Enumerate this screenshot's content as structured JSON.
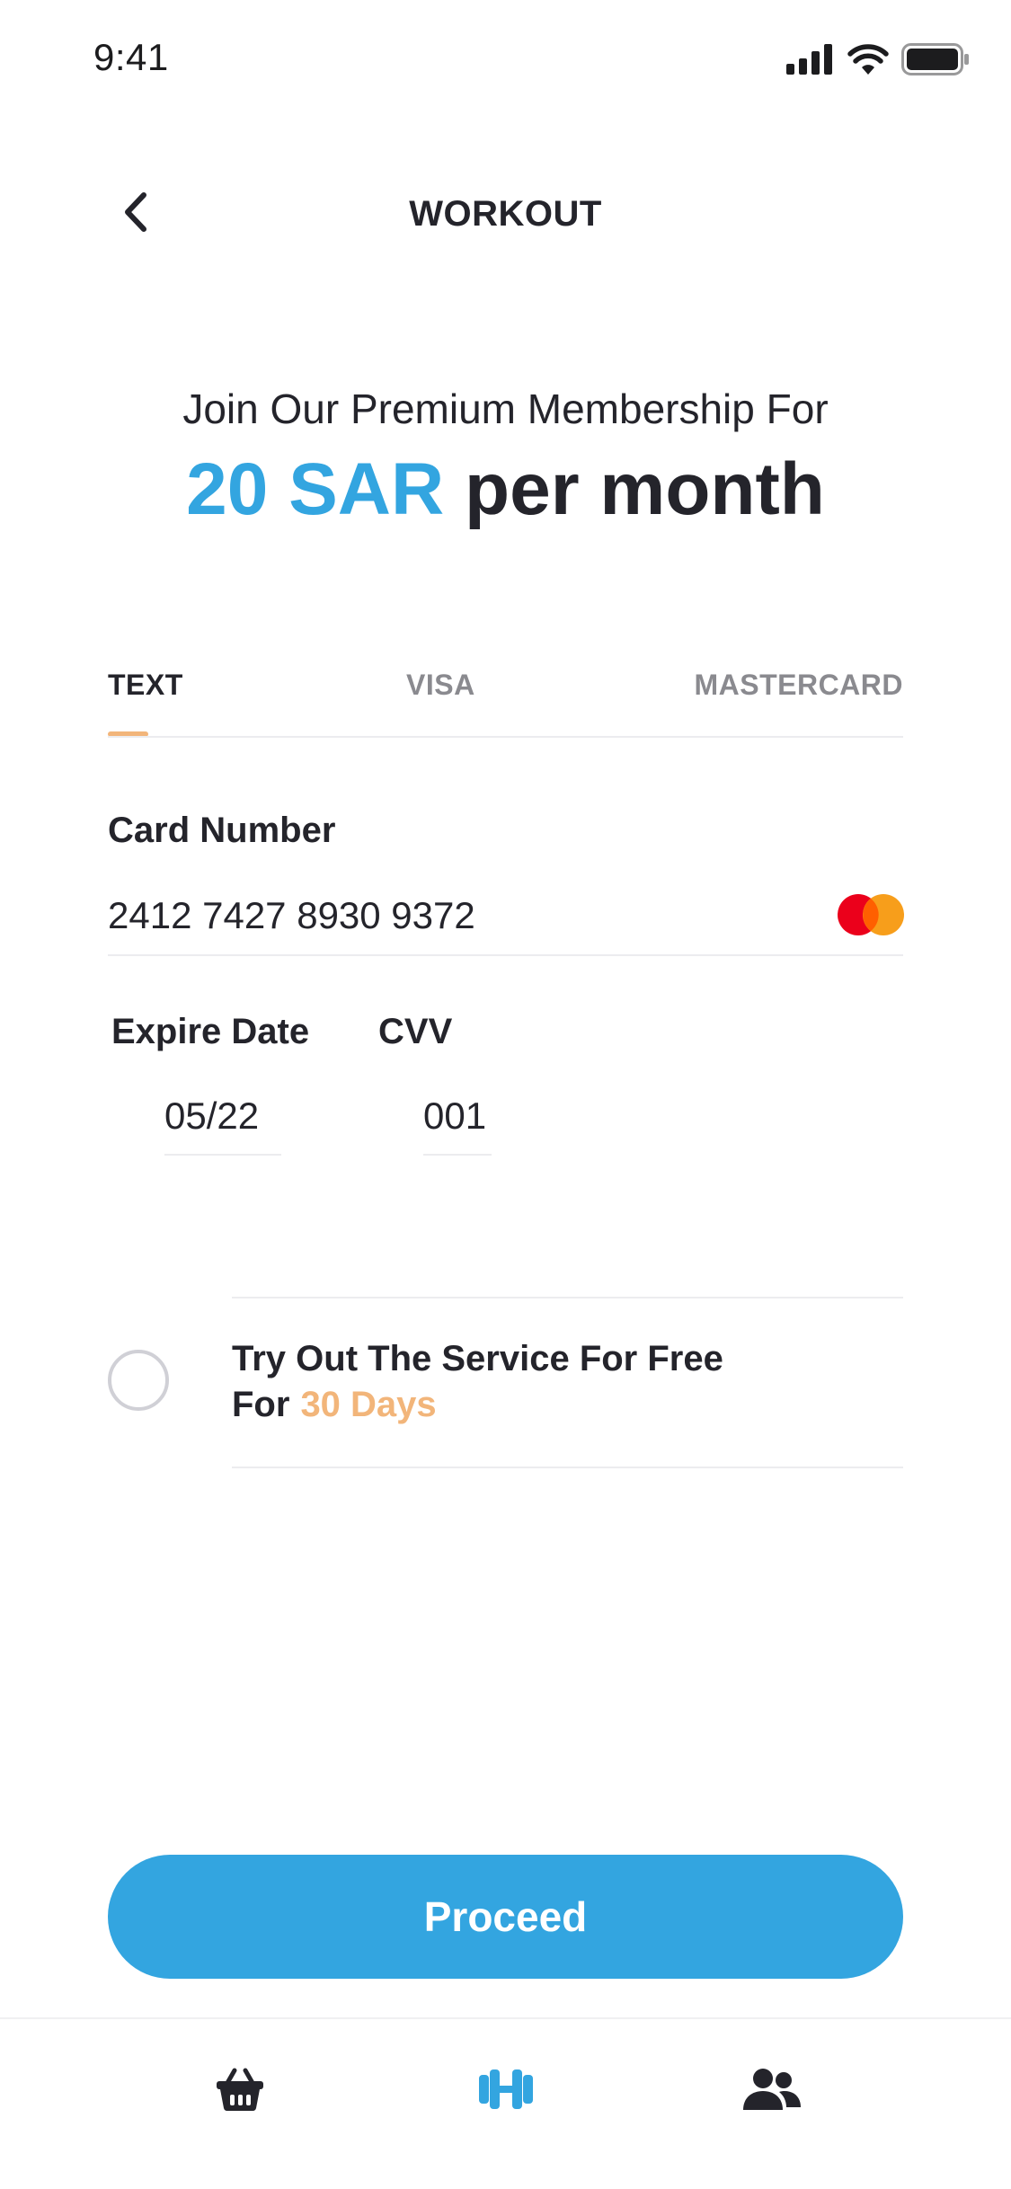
{
  "status_bar": {
    "time": "9:41"
  },
  "header": {
    "title": "WORKOUT",
    "back_icon": "chevron-left-icon"
  },
  "membership": {
    "intro": "Join Our Premium Membership For",
    "price_amount": "20 SAR",
    "price_period": "per month",
    "accent_color": "#33a5e0"
  },
  "tabs": [
    {
      "label": "TEXT",
      "active": true
    },
    {
      "label": "VISA",
      "active": false
    },
    {
      "label": "MASTERCARD",
      "active": false
    }
  ],
  "card": {
    "label": "Card Number",
    "number": "2412 7427 8930 9372",
    "brand_icon": "mastercard-logo"
  },
  "expiry": {
    "label": "Expire Date",
    "value": "05/22"
  },
  "cvv": {
    "label": "CVV",
    "value": "001"
  },
  "trial": {
    "line1": "Try Out The Service For Free",
    "line2_prefix": "For",
    "days": "30 Days",
    "highlight_color": "#f2b57a",
    "selected": false
  },
  "actions": {
    "proceed_label": "Proceed"
  },
  "bottom_nav": [
    {
      "icon": "shopping-basket-icon",
      "active": false
    },
    {
      "icon": "dumbbell-icon",
      "active": true
    },
    {
      "icon": "users-icon",
      "active": false
    }
  ]
}
